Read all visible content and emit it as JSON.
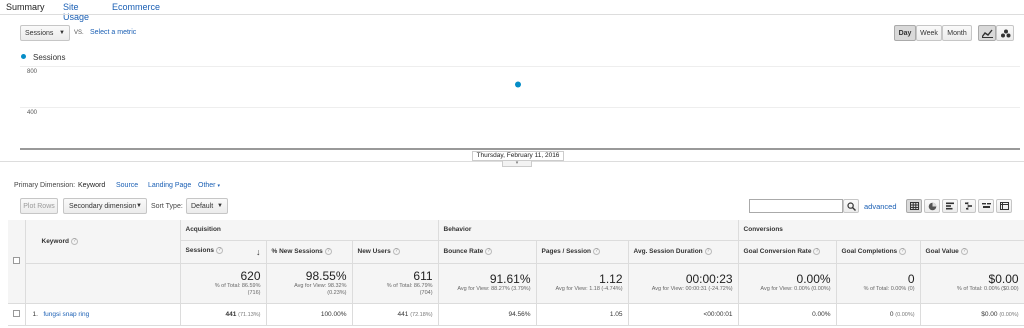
{
  "tabs": [
    "Summary",
    "Site Usage",
    "Ecommerce"
  ],
  "metric_select": {
    "value": "Sessions",
    "vs": "VS.",
    "select_link": "Select a metric"
  },
  "period_buttons": [
    "Day",
    "Week",
    "Month"
  ],
  "chart_data": {
    "type": "scatter",
    "series": [
      {
        "name": "Sessions",
        "values": [
          620
        ]
      }
    ],
    "x": [
      "Thursday, February 11, 2016"
    ],
    "yticks": [
      800,
      400
    ],
    "ylim": [
      0,
      1200
    ],
    "legend": "top-left",
    "color": "#058dc7"
  },
  "chart_labels": {
    "legend": "Sessions",
    "y_800": "800",
    "y_400": "400",
    "x_label": "Thursday, February 11, 2016"
  },
  "primary_dimension": {
    "label": "Primary Dimension:",
    "active": "Keyword",
    "options": [
      "Source",
      "Landing Page",
      "Other"
    ]
  },
  "toolbar": {
    "plot_rows": "Plot Rows",
    "secondary_dimension": "Secondary dimension",
    "sort_type_label": "Sort Type:",
    "sort_type_value": "Default",
    "advanced": "advanced"
  },
  "table": {
    "group_headers": [
      "Acquisition",
      "Behavior",
      "Conversions"
    ],
    "keyword_header": "Keyword",
    "columns": [
      "Sessions",
      "% New Sessions",
      "New Users",
      "Bounce Rate",
      "Pages / Session",
      "Avg. Session Duration",
      "Goal Conversion Rate",
      "Goal Completions",
      "Goal Value"
    ],
    "totals": [
      {
        "value": "620",
        "sub1": "% of Total: 86.59%",
        "sub2": "(716)"
      },
      {
        "value": "98.55%",
        "sub1": "Avg for View: 98.32%",
        "sub2": "(0.23%)"
      },
      {
        "value": "611",
        "sub1": "% of Total: 86.79%",
        "sub2": "(704)"
      },
      {
        "value": "91.61%",
        "sub1": "Avg for View: 88.27% (3.79%)",
        "sub2": ""
      },
      {
        "value": "1.12",
        "sub1": "Avg for View: 1.18 (-4.74%)",
        "sub2": ""
      },
      {
        "value": "00:00:23",
        "sub1": "Avg for View: 00:00:31 (-24.72%)",
        "sub2": ""
      },
      {
        "value": "0.00%",
        "sub1": "Avg for View: 0.00% (0.00%)",
        "sub2": ""
      },
      {
        "value": "0",
        "sub1": "% of Total: 0.00% (0)",
        "sub2": ""
      },
      {
        "value": "$0.00",
        "sub1": "% of Total: 0.00% ($0.00)",
        "sub2": ""
      }
    ],
    "rows": [
      {
        "index": "1.",
        "keyword": "fungsi snap ring",
        "sessions": "441",
        "sessions_pct": "(71.13%)",
        "new_sessions": "100.00%",
        "new_users": "441",
        "new_users_pct": "(72.18%)",
        "bounce_rate": "94.56%",
        "pages_session": "1.05",
        "avg_duration": "<00:00:01",
        "goal_conv_rate": "0.00%",
        "goal_completions": "0",
        "goal_completions_pct": "(0.00%)",
        "goal_value": "$0.00",
        "goal_value_pct": "(0.00%)"
      }
    ]
  }
}
